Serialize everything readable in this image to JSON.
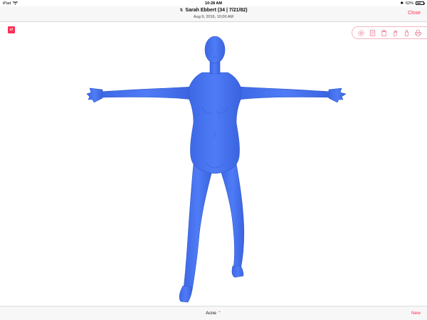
{
  "status_bar": {
    "device": "iPad",
    "time": "10:28 AM",
    "battery_percent": "62%",
    "battery_level": 0.62
  },
  "header": {
    "patient_title": "Sarah Ebbert (34 | 7/21/82)",
    "visit_datetime": "Aug 9, 2016, 10:00 AM",
    "close_label": "Close",
    "swap_icon": "swap-vertical-icon"
  },
  "toolbar": {
    "icons": [
      "gear-icon",
      "notes-icon",
      "trash-icon",
      "hand-icon",
      "bottle-icon",
      "print-icon"
    ]
  },
  "model": {
    "color": "#4f7cf6"
  },
  "footer": {
    "condition": "Acne",
    "new_label": "New"
  },
  "colors": {
    "accent": "#ff2d55"
  }
}
